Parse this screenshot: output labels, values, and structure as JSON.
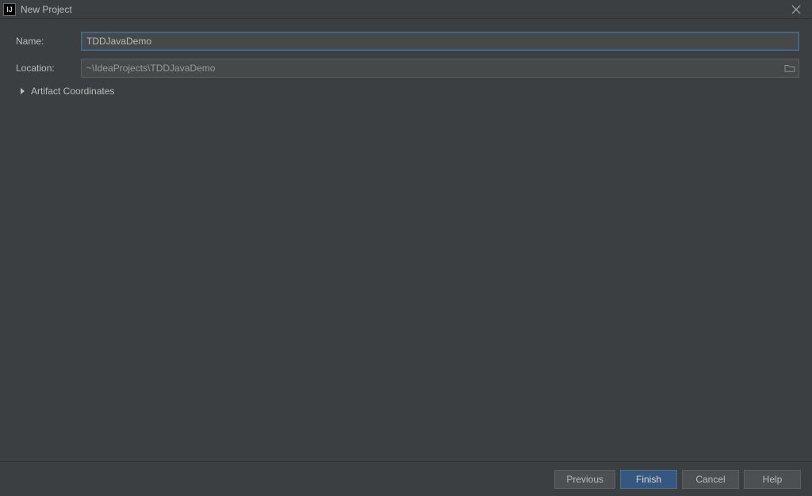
{
  "window": {
    "title": "New Project",
    "icon_glyph": "IJ"
  },
  "form": {
    "name_label": "Name:",
    "name_value": "TDDJavaDemo",
    "location_label": "Location:",
    "location_value": "~\\IdeaProjects\\TDDJavaDemo",
    "artifact_label": "Artifact Coordinates"
  },
  "buttons": {
    "previous": "Previous",
    "finish": "Finish",
    "cancel": "Cancel",
    "help": "Help"
  }
}
